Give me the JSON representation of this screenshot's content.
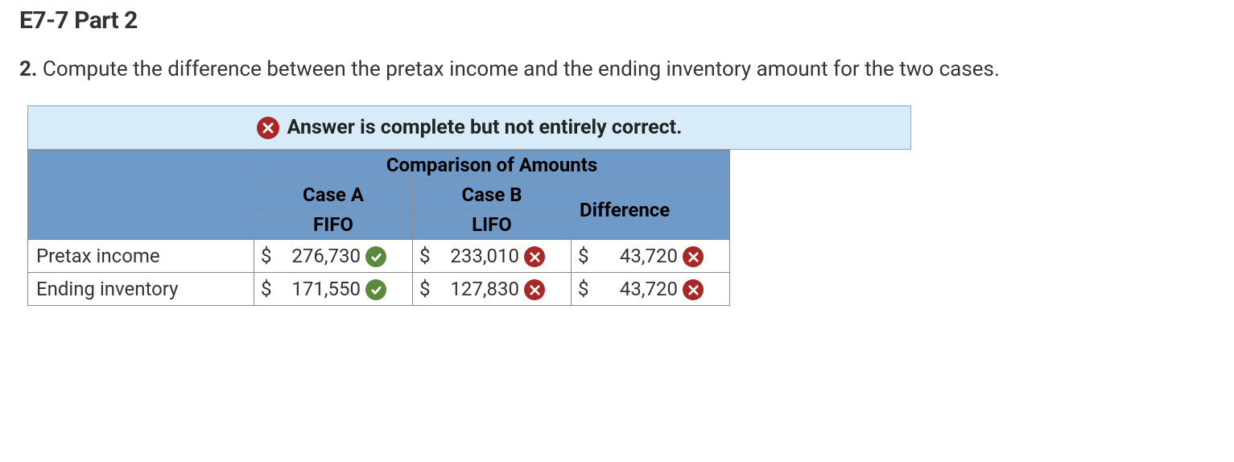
{
  "title": "E7-7 Part 2",
  "question_number": "2.",
  "question_text": "Compute the difference between the pretax income and the ending inventory amount for the two cases.",
  "feedback": {
    "status": "incorrect",
    "message": "Answer is complete but not entirely correct."
  },
  "table": {
    "group_header": "Comparison of Amounts",
    "col_headers": {
      "case_a": "Case A",
      "case_b": "Case B",
      "fifo": "FIFO",
      "lifo": "LIFO",
      "difference": "Difference"
    },
    "rows": [
      {
        "label": "Pretax income",
        "case_a": {
          "currency": "$",
          "value": "276,730",
          "status": "correct"
        },
        "case_b": {
          "currency": "$",
          "value": "233,010",
          "status": "incorrect"
        },
        "difference": {
          "currency": "$",
          "value": "43,720",
          "status": "incorrect"
        }
      },
      {
        "label": "Ending inventory",
        "case_a": {
          "currency": "$",
          "value": "171,550",
          "status": "correct"
        },
        "case_b": {
          "currency": "$",
          "value": "127,830",
          "status": "incorrect"
        },
        "difference": {
          "currency": "$",
          "value": "43,720",
          "status": "incorrect"
        }
      }
    ]
  }
}
